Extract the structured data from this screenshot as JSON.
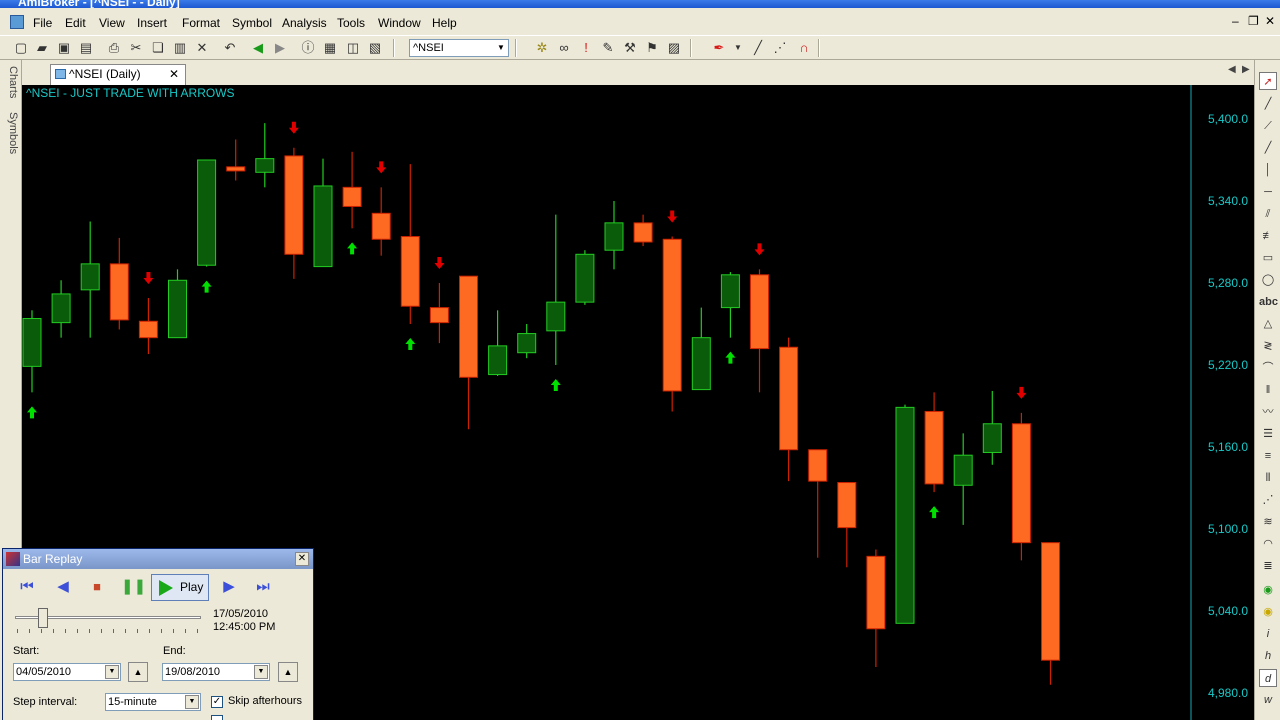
{
  "window": {
    "title": "AmiBroker - [^NSEI - - Daily]"
  },
  "menu": [
    "File",
    "Edit",
    "View",
    "Insert",
    "Format",
    "Symbol",
    "Analysis",
    "Tools",
    "Window",
    "Help"
  ],
  "toolbar": {
    "symbol": "^NSEI"
  },
  "side_tabs": [
    "Charts",
    "Symbols"
  ],
  "tab": {
    "label": "^NSEI (Daily)"
  },
  "chart": {
    "title": "^NSEI - JUST TRADE WITH ARROWS",
    "colors": {
      "up": "#0a5c0a",
      "down": "#ff6a22",
      "up_outline": "#22cc22",
      "down_outline": "#cc2200",
      "buy_arrow": "#00e000",
      "sell_arrow": "#e00000",
      "axis_text": "#18c8c8"
    }
  },
  "chart_data": {
    "type": "candlestick",
    "y_ticks": [
      "5,400.0",
      "5,340.0",
      "5,280.0",
      "5,220.0",
      "5,160.0",
      "5,100.0",
      "5,040.0",
      "4,980.0"
    ],
    "y_tick_values": [
      5400,
      5340,
      5280,
      5220,
      5160,
      5100,
      5040,
      4980
    ],
    "candles": [
      {
        "o": 5219,
        "h": 5260,
        "l": 5200,
        "c": 5254
      },
      {
        "o": 5251,
        "h": 5282,
        "l": 5240,
        "c": 5272
      },
      {
        "o": 5275,
        "h": 5325,
        "l": 5240,
        "c": 5294
      },
      {
        "o": 5294,
        "h": 5313,
        "l": 5246,
        "c": 5253
      },
      {
        "o": 5252,
        "h": 5269,
        "l": 5228,
        "c": 5240
      },
      {
        "o": 5240,
        "h": 5290,
        "l": 5240,
        "c": 5282
      },
      {
        "o": 5293,
        "h": 5370,
        "l": 5292,
        "c": 5370
      },
      {
        "o": 5365,
        "h": 5385,
        "l": 5355,
        "c": 5362
      },
      {
        "o": 5361,
        "h": 5397,
        "l": 5350,
        "c": 5371
      },
      {
        "o": 5373,
        "h": 5379,
        "l": 5283,
        "c": 5301
      },
      {
        "o": 5292,
        "h": 5371,
        "l": 5292,
        "c": 5351
      },
      {
        "o": 5350,
        "h": 5376,
        "l": 5320,
        "c": 5336
      },
      {
        "o": 5331,
        "h": 5350,
        "l": 5300,
        "c": 5312
      },
      {
        "o": 5314,
        "h": 5367,
        "l": 5250,
        "c": 5263
      },
      {
        "o": 5262,
        "h": 5280,
        "l": 5236,
        "c": 5251
      },
      {
        "o": 5285,
        "h": 5285,
        "l": 5173,
        "c": 5211
      },
      {
        "o": 5213,
        "h": 5260,
        "l": 5212,
        "c": 5234
      },
      {
        "o": 5229,
        "h": 5250,
        "l": 5225,
        "c": 5243
      },
      {
        "o": 5245,
        "h": 5330,
        "l": 5220,
        "c": 5266
      },
      {
        "o": 5266,
        "h": 5304,
        "l": 5264,
        "c": 5301
      },
      {
        "o": 5304,
        "h": 5340,
        "l": 5290,
        "c": 5324
      },
      {
        "o": 5324,
        "h": 5330,
        "l": 5307,
        "c": 5310
      },
      {
        "o": 5312,
        "h": 5314,
        "l": 5186,
        "c": 5201
      },
      {
        "o": 5202,
        "h": 5262,
        "l": 5202,
        "c": 5240
      },
      {
        "o": 5262,
        "h": 5288,
        "l": 5240,
        "c": 5286
      },
      {
        "o": 5286,
        "h": 5290,
        "l": 5200,
        "c": 5232
      },
      {
        "o": 5233,
        "h": 5240,
        "l": 5135,
        "c": 5158
      },
      {
        "o": 5158,
        "h": 5158,
        "l": 5079,
        "c": 5135
      },
      {
        "o": 5134,
        "h": 5134,
        "l": 5072,
        "c": 5101
      },
      {
        "o": 5080,
        "h": 5085,
        "l": 4999,
        "c": 5027
      },
      {
        "o": 5031,
        "h": 5191,
        "l": 5031,
        "c": 5189
      },
      {
        "o": 5186,
        "h": 5200,
        "l": 5127,
        "c": 5133
      },
      {
        "o": 5132,
        "h": 5170,
        "l": 5103,
        "c": 5154
      },
      {
        "o": 5156,
        "h": 5201,
        "l": 5147,
        "c": 5177
      },
      {
        "o": 5177,
        "h": 5185,
        "l": 5077,
        "c": 5090
      },
      {
        "o": 5090,
        "h": 5090,
        "l": 4986,
        "c": 5004
      }
    ],
    "buy_arrows": [
      0,
      6,
      11,
      13,
      18,
      24,
      31
    ],
    "sell_arrows": [
      4,
      9,
      12,
      14,
      22,
      25,
      34
    ]
  },
  "replay": {
    "title": "Bar Replay",
    "play_label": "Play",
    "current_date": "17/05/2010",
    "current_time": "12:45:00 PM",
    "position_fraction": 0.15,
    "start_label": "Start:",
    "start_value": "04/05/2010",
    "end_label": "End:",
    "end_value": "19/08/2010",
    "step_label": "Step interval:",
    "step_value": "15-minute",
    "skip_label": "Skip afterhours"
  }
}
